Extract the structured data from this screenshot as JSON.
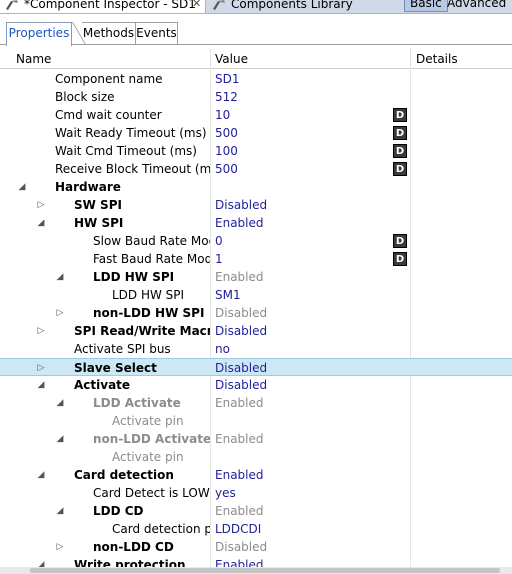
{
  "view_tabs": {
    "inspector_label": "*Component Inspector - SD1",
    "inspector_close": "✕",
    "library_label": "Components Library",
    "basic_label": "Basic",
    "advanced_label": "Advanced"
  },
  "sub_tabs": [
    "Properties",
    "Methods",
    "Events"
  ],
  "columns": {
    "name": "Name",
    "value": "Value",
    "details": "Details"
  },
  "rows": [
    {
      "name": "Component name",
      "value": "SD1",
      "level": 2,
      "arrow": "",
      "bold": false,
      "name_gray": false,
      "value_gray": false,
      "d": false
    },
    {
      "name": "Block size",
      "value": "512",
      "level": 2,
      "arrow": "",
      "bold": false,
      "name_gray": false,
      "value_gray": false,
      "d": false
    },
    {
      "name": "Cmd wait counter",
      "value": "10",
      "level": 2,
      "arrow": "",
      "bold": false,
      "name_gray": false,
      "value_gray": false,
      "d": true
    },
    {
      "name": "Wait Ready Timeout (ms)",
      "value": "500",
      "level": 2,
      "arrow": "",
      "bold": false,
      "name_gray": false,
      "value_gray": false,
      "d": true
    },
    {
      "name": "Wait Cmd Timeout (ms)",
      "value": "100",
      "level": 2,
      "arrow": "",
      "bold": false,
      "name_gray": false,
      "value_gray": false,
      "d": true
    },
    {
      "name": "Receive Block Timeout (ms)",
      "value": "500",
      "level": 2,
      "arrow": "",
      "bold": false,
      "name_gray": false,
      "value_gray": false,
      "d": true
    },
    {
      "name": "Hardware",
      "value": "",
      "level": 1,
      "arrow": "expanded",
      "bold": true,
      "name_gray": false,
      "value_gray": false,
      "d": false
    },
    {
      "name": "SW SPI",
      "value": "Disabled",
      "level": 2,
      "arrow": "collapsed",
      "bold": true,
      "name_gray": false,
      "value_gray": false,
      "d": false
    },
    {
      "name": "HW SPI",
      "value": "Enabled",
      "level": 2,
      "arrow": "expanded",
      "bold": true,
      "name_gray": false,
      "value_gray": false,
      "d": false
    },
    {
      "name": "Slow Baud Rate Mode",
      "value": "0",
      "level": 3,
      "arrow": "",
      "bold": false,
      "name_gray": false,
      "value_gray": false,
      "d": true
    },
    {
      "name": "Fast Baud Rate Mode",
      "value": "1",
      "level": 3,
      "arrow": "",
      "bold": false,
      "name_gray": false,
      "value_gray": false,
      "d": true
    },
    {
      "name": "LDD HW SPI",
      "value": "Enabled",
      "level": 3,
      "arrow": "expanded",
      "bold": true,
      "name_gray": false,
      "value_gray": true,
      "d": false
    },
    {
      "name": "LDD HW SPI",
      "value": "SM1",
      "level": 4,
      "arrow": "",
      "bold": false,
      "name_gray": false,
      "value_gray": false,
      "d": false
    },
    {
      "name": "non-LDD HW SPI",
      "value": "Disabled",
      "level": 3,
      "arrow": "collapsed",
      "bold": true,
      "name_gray": false,
      "value_gray": true,
      "d": false
    },
    {
      "name": "SPI Read/Write Macros",
      "value": "Disabled",
      "level": 2,
      "arrow": "collapsed",
      "bold": true,
      "name_gray": false,
      "value_gray": false,
      "d": false
    },
    {
      "name": "Activate SPI bus",
      "value": "no",
      "level": 2,
      "arrow": "",
      "bold": false,
      "name_gray": false,
      "value_gray": false,
      "d": false
    },
    {
      "name": "Slave Select",
      "value": "Disabled",
      "level": 2,
      "arrow": "collapsed",
      "bold": true,
      "name_gray": false,
      "value_gray": false,
      "d": false,
      "selected": true
    },
    {
      "name": "Activate",
      "value": "Disabled",
      "level": 2,
      "arrow": "expanded",
      "bold": true,
      "name_gray": false,
      "value_gray": false,
      "d": false
    },
    {
      "name": "LDD Activate",
      "value": "Enabled",
      "level": 3,
      "arrow": "expanded",
      "bold": true,
      "name_gray": true,
      "value_gray": true,
      "d": false
    },
    {
      "name": "Activate pin",
      "value": "",
      "level": 4,
      "arrow": "",
      "bold": false,
      "name_gray": true,
      "value_gray": true,
      "d": false
    },
    {
      "name": "non-LDD Activate",
      "value": "Enabled",
      "level": 3,
      "arrow": "expanded",
      "bold": true,
      "name_gray": true,
      "value_gray": true,
      "d": false
    },
    {
      "name": "Activate pin",
      "value": "",
      "level": 4,
      "arrow": "",
      "bold": false,
      "name_gray": true,
      "value_gray": true,
      "d": false
    },
    {
      "name": "Card detection",
      "value": "Enabled",
      "level": 2,
      "arrow": "expanded",
      "bold": true,
      "name_gray": false,
      "value_gray": false,
      "d": false
    },
    {
      "name": "Card Detect is LOW active",
      "value": "yes",
      "level": 3,
      "arrow": "",
      "bold": false,
      "name_gray": false,
      "value_gray": false,
      "d": false
    },
    {
      "name": "LDD CD",
      "value": "Enabled",
      "level": 3,
      "arrow": "expanded",
      "bold": true,
      "name_gray": false,
      "value_gray": true,
      "d": false
    },
    {
      "name": "Card detection pin",
      "value": "LDDCDI",
      "level": 4,
      "arrow": "",
      "bold": false,
      "name_gray": false,
      "value_gray": false,
      "d": false
    },
    {
      "name": "non-LDD CD",
      "value": "Disabled",
      "level": 3,
      "arrow": "collapsed",
      "bold": true,
      "name_gray": false,
      "value_gray": true,
      "d": false
    },
    {
      "name": "Write protection",
      "value": "Enabled",
      "level": 2,
      "arrow": "expanded",
      "bold": true,
      "name_gray": false,
      "value_gray": false,
      "d": false
    }
  ],
  "d_button_label": "D",
  "colors": {
    "selected_row": "#cde8f5",
    "value_blue": "#1f1f99",
    "disabled_gray": "#8c8c8c",
    "tab_active": "#1b55c5"
  }
}
